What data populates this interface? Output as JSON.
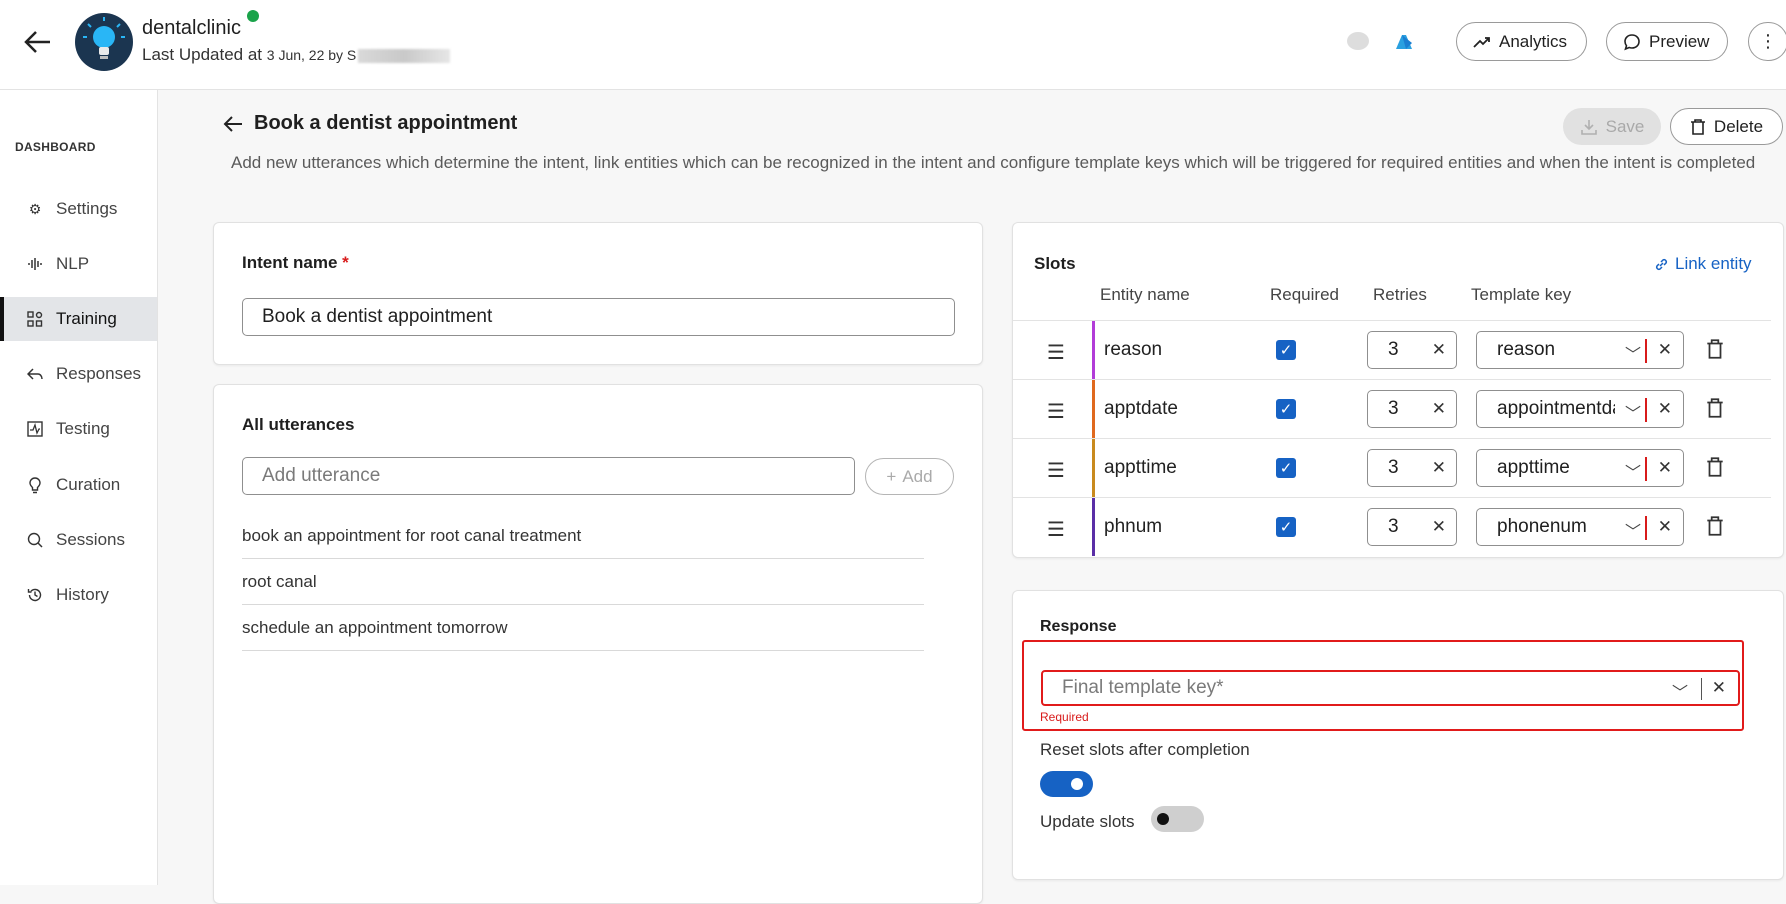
{
  "header": {
    "bot_name": "dentalclinic",
    "last_updated_prefix": "Last Updated at ",
    "last_updated_date": "3 Jun, 22 by S",
    "analytics_label": "Analytics",
    "preview_label": "Preview"
  },
  "sidebar": {
    "heading": "DASHBOARD",
    "items": [
      {
        "label": "Settings",
        "icon": "gear-icon"
      },
      {
        "label": "NLP",
        "icon": "waveform-icon"
      },
      {
        "label": "Training",
        "icon": "training-icon",
        "active": true
      },
      {
        "label": "Responses",
        "icon": "reply-icon"
      },
      {
        "label": "Testing",
        "icon": "pulse-icon"
      },
      {
        "label": "Curation",
        "icon": "bulb-icon"
      },
      {
        "label": "Sessions",
        "icon": "chat-search-icon"
      },
      {
        "label": "History",
        "icon": "history-icon"
      }
    ]
  },
  "page": {
    "title": "Book a dentist appointment",
    "description": "Add new utterances which determine the intent, link entities which can be recognized in the intent and configure template keys which will be triggered for required entities and when the intent is completed",
    "save_label": "Save",
    "delete_label": "Delete"
  },
  "intent": {
    "label": "Intent name",
    "required_mark": "*",
    "value": "Book a dentist appointment"
  },
  "utterances": {
    "title": "All utterances",
    "placeholder": "Add utterance",
    "add_label": "Add",
    "items": [
      "book an appointment for root canal treatment",
      "root canal",
      "schedule an appointment tomorrow"
    ]
  },
  "slots": {
    "title": "Slots",
    "link_entity_label": "Link entity",
    "columns": [
      "Entity name",
      "Required",
      "Retries",
      "Template key"
    ],
    "rows": [
      {
        "entity": "reason",
        "required": true,
        "retries": "3",
        "template_key": "reason",
        "color": "#b23cd8"
      },
      {
        "entity": "apptdate",
        "required": true,
        "retries": "3",
        "template_key": "appointmentdate",
        "color": "#e0691e"
      },
      {
        "entity": "appttime",
        "required": true,
        "retries": "3",
        "template_key": "appttime",
        "color": "#c98a1e"
      },
      {
        "entity": "phnum",
        "required": true,
        "retries": "3",
        "template_key": "phonenum",
        "color": "#5a2ea6"
      }
    ]
  },
  "response": {
    "title": "Response",
    "final_key_placeholder": "Final template key*",
    "required_text": "Required",
    "reset_label": "Reset slots after completion",
    "reset_on": true,
    "update_label": "Update slots",
    "update_on": false
  },
  "colors": {
    "accent": "#1662c4",
    "error": "#e11b1b"
  }
}
